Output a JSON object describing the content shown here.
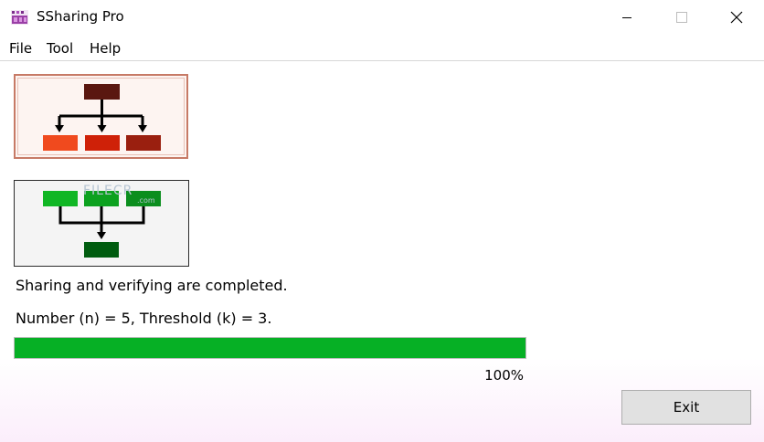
{
  "window": {
    "title": "SSharing Pro"
  },
  "menu": {
    "items": [
      {
        "label": "File"
      },
      {
        "label": "Tool"
      },
      {
        "label": "Help"
      }
    ]
  },
  "watermark": {
    "text": "FILECR",
    "sub": ".com"
  },
  "status": {
    "message": "Sharing and verifying are completed.",
    "params": "Number (n) = 5, Threshold (k) = 3."
  },
  "progress": {
    "value": 1.0,
    "label": "100%"
  },
  "buttons": {
    "exit": "Exit"
  },
  "colors": {
    "progress_fill": "#06b025",
    "share_top": "#5a1710",
    "share_boxes": [
      "#f04a1e",
      "#cf2108",
      "#9a1f0f"
    ],
    "verify_top": [
      "#10b624",
      "#0ca11f",
      "#0b8e1e"
    ],
    "verify_bottom": "#005c0f"
  },
  "icons": {
    "app": "app-logo-icon",
    "minimize": "minimize-icon",
    "maximize": "maximize-icon",
    "close": "close-icon"
  }
}
